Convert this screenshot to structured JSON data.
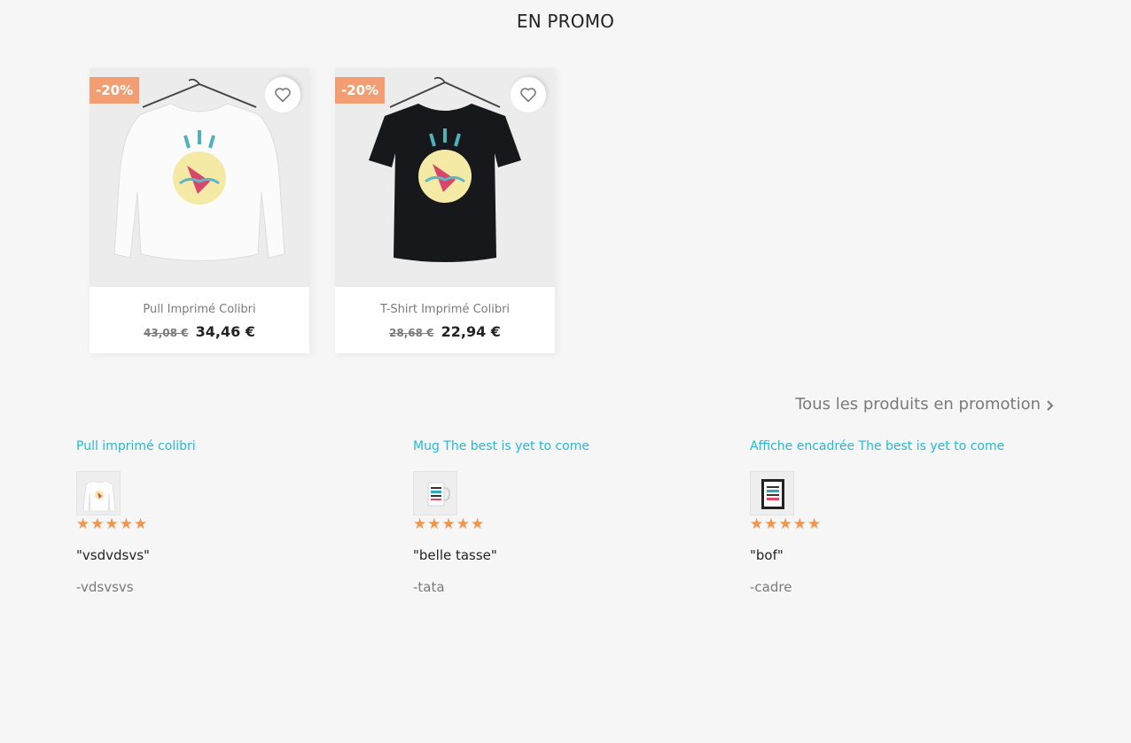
{
  "section": {
    "title": "EN PROMO"
  },
  "products": [
    {
      "discount": "-20%",
      "name": "Pull Imprimé Colibri",
      "regular_price": "43,08 €",
      "price": "34,46 €",
      "wishlist_icon": "heart-outline-icon",
      "image": "white-long-sleeve-hummingbird"
    },
    {
      "discount": "-20%",
      "name": "T-Shirt Imprimé Colibri",
      "regular_price": "28,68 €",
      "price": "22,94 €",
      "wishlist_icon": "heart-outline-icon",
      "image": "black-tshirt-hummingbird"
    }
  ],
  "all_link": {
    "label": "Tous les produits en promotion",
    "icon": "chevron-right-icon"
  },
  "reviews": [
    {
      "product": "Pull imprimé colibri",
      "stars": "★★★★★",
      "rating": 5,
      "quote": "\"vsdvdsvs\"",
      "author": "-vdsvsvs"
    },
    {
      "product": "Mug The best is yet to come",
      "stars": "★★★★★",
      "rating": 5,
      "quote": "\"belle tasse\"",
      "author": "-tata"
    },
    {
      "product": "Affiche encadrée The best is yet to come",
      "stars": "★★★★★",
      "rating": 5,
      "quote": "\"bof\"",
      "author": "-cadre"
    }
  ],
  "colors": {
    "accent": "#24b9d7",
    "discount_badge": "#f39d72",
    "stars": "#f3944a",
    "text": "#232323",
    "muted": "#7a7a7a"
  }
}
